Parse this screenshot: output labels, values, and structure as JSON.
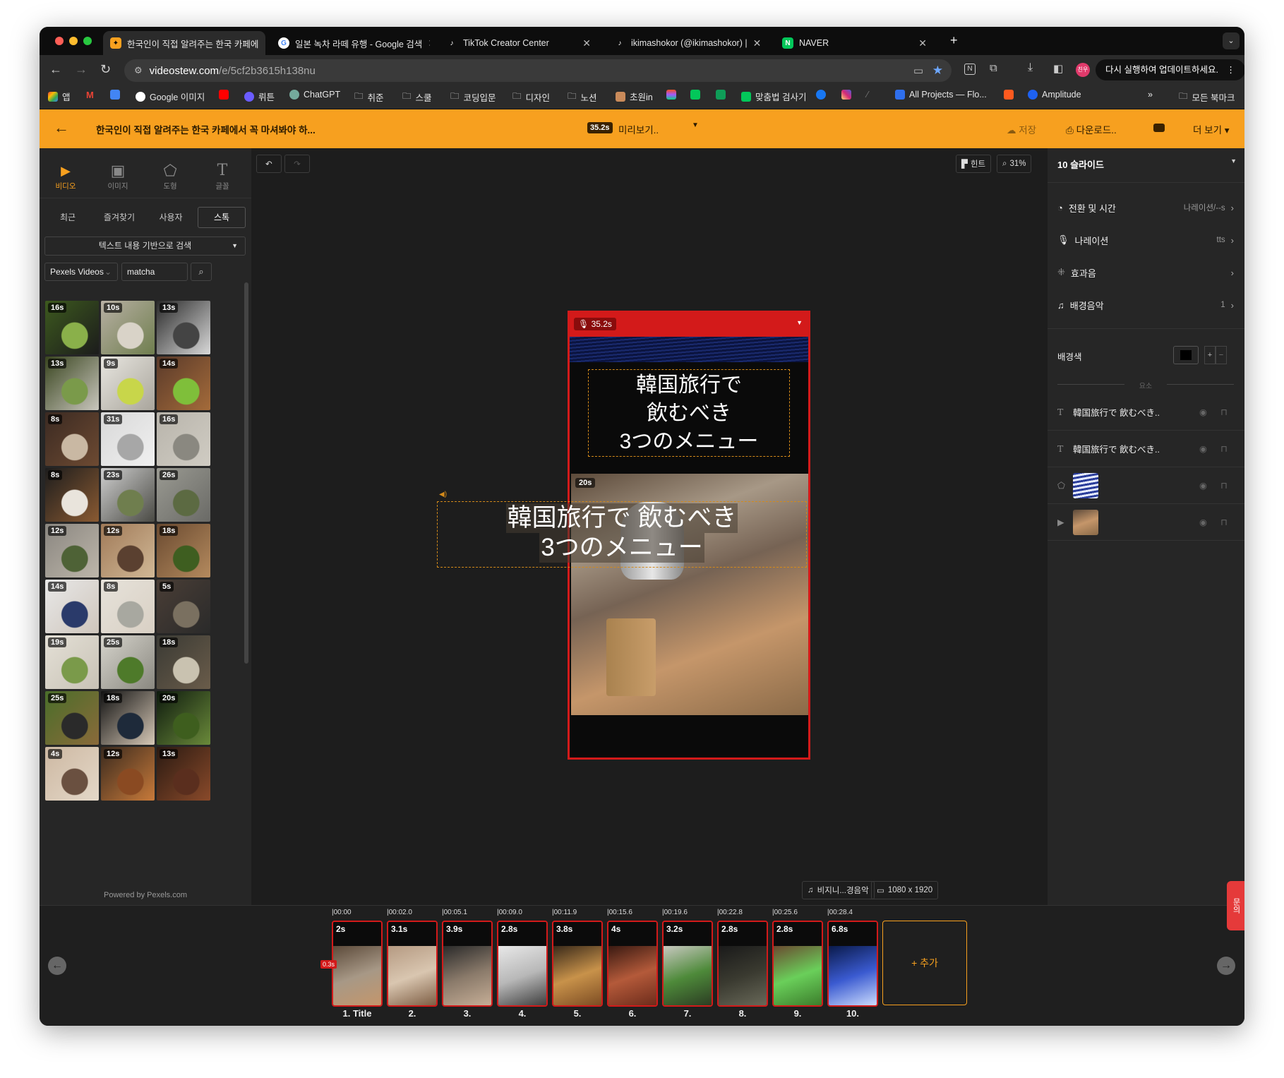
{
  "browser": {
    "tabs": [
      {
        "title": "한국인이 직접 알려주는 한국 카페에",
        "active": true
      },
      {
        "title": "일본 녹차 라떼 유행 - Google 검색"
      },
      {
        "title": "TikTok Creator Center"
      },
      {
        "title": "ikimashokor (@ikimashokor) |"
      },
      {
        "title": "NAVER"
      }
    ],
    "new_tab": "+",
    "url_host": "videostew.com",
    "url_path": "/e/5cf2b3615h138nu",
    "profile": "친우",
    "update_button": "다시 실행하여 업데이트하세요.",
    "bookmarks": [
      "앱",
      "Google 이미지",
      "뤼튼",
      "ChatGPT",
      "취준",
      "스쿨",
      "코딩입문",
      "디자인",
      "노션",
      "초원in",
      "맞춤법 검사기",
      "All Projects — Flo...",
      "Amplitude"
    ],
    "all_bookmarks": "모든 북마크",
    "more": "»"
  },
  "editor": {
    "back": "←",
    "project_title": "한국인이 직접 알려주는 한국 카페에서 꼭 마셔봐야 하...",
    "duration_badge": "35.2s",
    "preview": "미리보기..",
    "save": "저장",
    "download": "다운로드..",
    "more": "더 보기"
  },
  "left": {
    "tools": [
      {
        "label": "비디오",
        "glyph": "▶"
      },
      {
        "label": "이미지",
        "glyph": "▣"
      },
      {
        "label": "도형",
        "glyph": "⬠"
      },
      {
        "label": "글꼴",
        "glyph": "T"
      }
    ],
    "subtabs": [
      "최근",
      "즐겨찾기",
      "사용자",
      "스톡"
    ],
    "search_mode": "텍스트 내용 기반으로 검색",
    "source": "Pexels Videos",
    "query": "matcha",
    "durations": [
      "16s",
      "10s",
      "13s",
      "13s",
      "9s",
      "14s",
      "8s",
      "31s",
      "16s",
      "8s",
      "23s",
      "26s",
      "12s",
      "12s",
      "18s",
      "14s",
      "8s",
      "5s",
      "19s",
      "25s",
      "18s",
      "25s",
      "18s",
      "20s",
      "4s",
      "12s",
      "13s"
    ],
    "footer": "Powered by Pexels.com"
  },
  "canvas": {
    "hint": "힌트",
    "zoom": "31%",
    "voice_duration": "35.2s",
    "clip_duration": "20s",
    "title_line1": "韓国旅行で",
    "title_line2": "飲むべき",
    "title_line3": "3つのメニュー",
    "overlay_line1": "韓国旅行で 飲むべき",
    "overlay_line2": "3つのメニュー",
    "bgm": "비지니...경음악",
    "resolution": "1080 x 1920"
  },
  "right": {
    "slides_count": "10 슬라이드",
    "transition": {
      "label": "전환 및 시간",
      "value": "나레이션/--s"
    },
    "narration": {
      "label": "나레이션",
      "value": "tts"
    },
    "sfx": {
      "label": "효과음",
      "value": ""
    },
    "bgm": {
      "label": "배경음악",
      "value": "1"
    },
    "bg_color_label": "배경색",
    "bg_color": "#000000",
    "elements_label": "요소",
    "layers": [
      {
        "type": "T",
        "text": "韓国旅行で 飲むべき.."
      },
      {
        "type": "T",
        "text": "韓国旅行で 飲むべき.."
      },
      {
        "type": "shape",
        "text": ""
      },
      {
        "type": "video",
        "text": ""
      }
    ]
  },
  "timeline": {
    "ticks": [
      "00:00",
      "00:02.0",
      "00:05.1",
      "00:09.0",
      "00:11.9",
      "00:15.6",
      "00:19.6",
      "00:22.8",
      "00:25.6",
      "00:28.4"
    ],
    "slides": [
      {
        "dur": "2s",
        "label": "1. Title"
      },
      {
        "dur": "3.1s",
        "label": "2."
      },
      {
        "dur": "3.9s",
        "label": "3."
      },
      {
        "dur": "2.8s",
        "label": "4."
      },
      {
        "dur": "3.8s",
        "label": "5."
      },
      {
        "dur": "4s",
        "label": "6."
      },
      {
        "dur": "3.2s",
        "label": "7."
      },
      {
        "dur": "2.8s",
        "label": "8."
      },
      {
        "dur": "2.8s",
        "label": "9."
      },
      {
        "dur": "6.8s",
        "label": "10."
      }
    ],
    "first_marker": "0.3s",
    "add": "+ 추가",
    "inquiry": "문의"
  }
}
